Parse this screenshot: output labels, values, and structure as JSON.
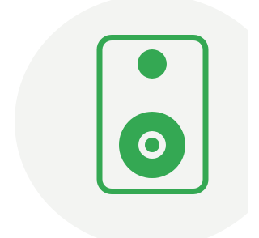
{
  "colors": {
    "background": "#ffffff",
    "circle": "#f3f4f2",
    "accent": "#34a853"
  },
  "icon": {
    "name": "speaker-icon"
  }
}
